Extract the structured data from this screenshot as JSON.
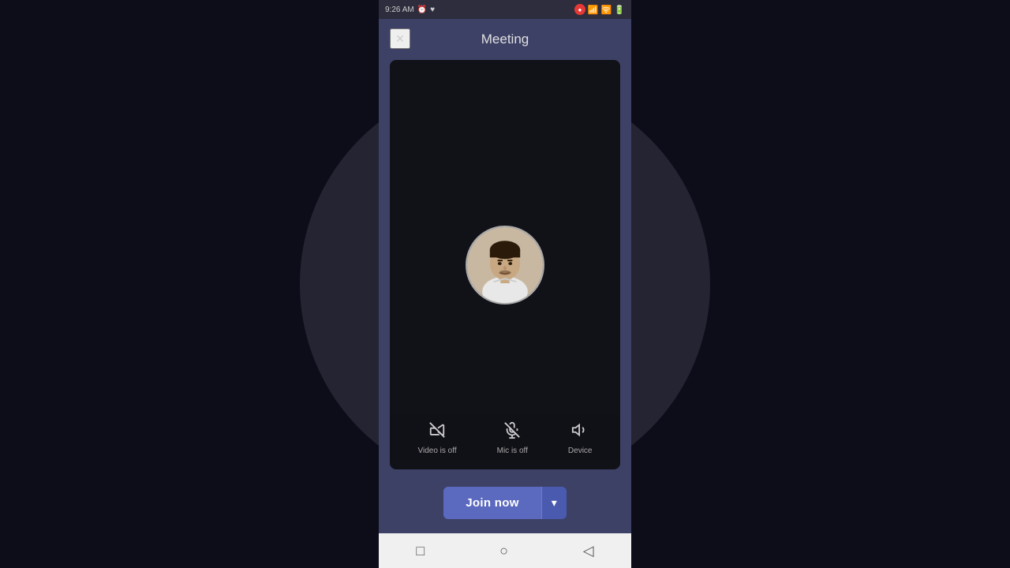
{
  "statusBar": {
    "time": "9:26 AM",
    "rightIcons": [
      "record",
      "signal",
      "wifi",
      "battery"
    ]
  },
  "dialog": {
    "title": "Meeting",
    "closeLabel": "×"
  },
  "controls": [
    {
      "id": "video",
      "icon": "🎥",
      "label": "Video is off",
      "off": true
    },
    {
      "id": "mic",
      "icon": "🎤",
      "label": "Mic is off",
      "off": true
    },
    {
      "id": "device",
      "icon": "🔊",
      "label": "Device",
      "off": false
    }
  ],
  "joinButton": {
    "label": "Join now",
    "chevron": "▾"
  },
  "navBar": {
    "items": [
      "□",
      "○",
      "◁"
    ]
  },
  "colors": {
    "dialogBg": "#3d4166",
    "videoBg": "#111118",
    "joinBtn": "#5b6abf"
  }
}
